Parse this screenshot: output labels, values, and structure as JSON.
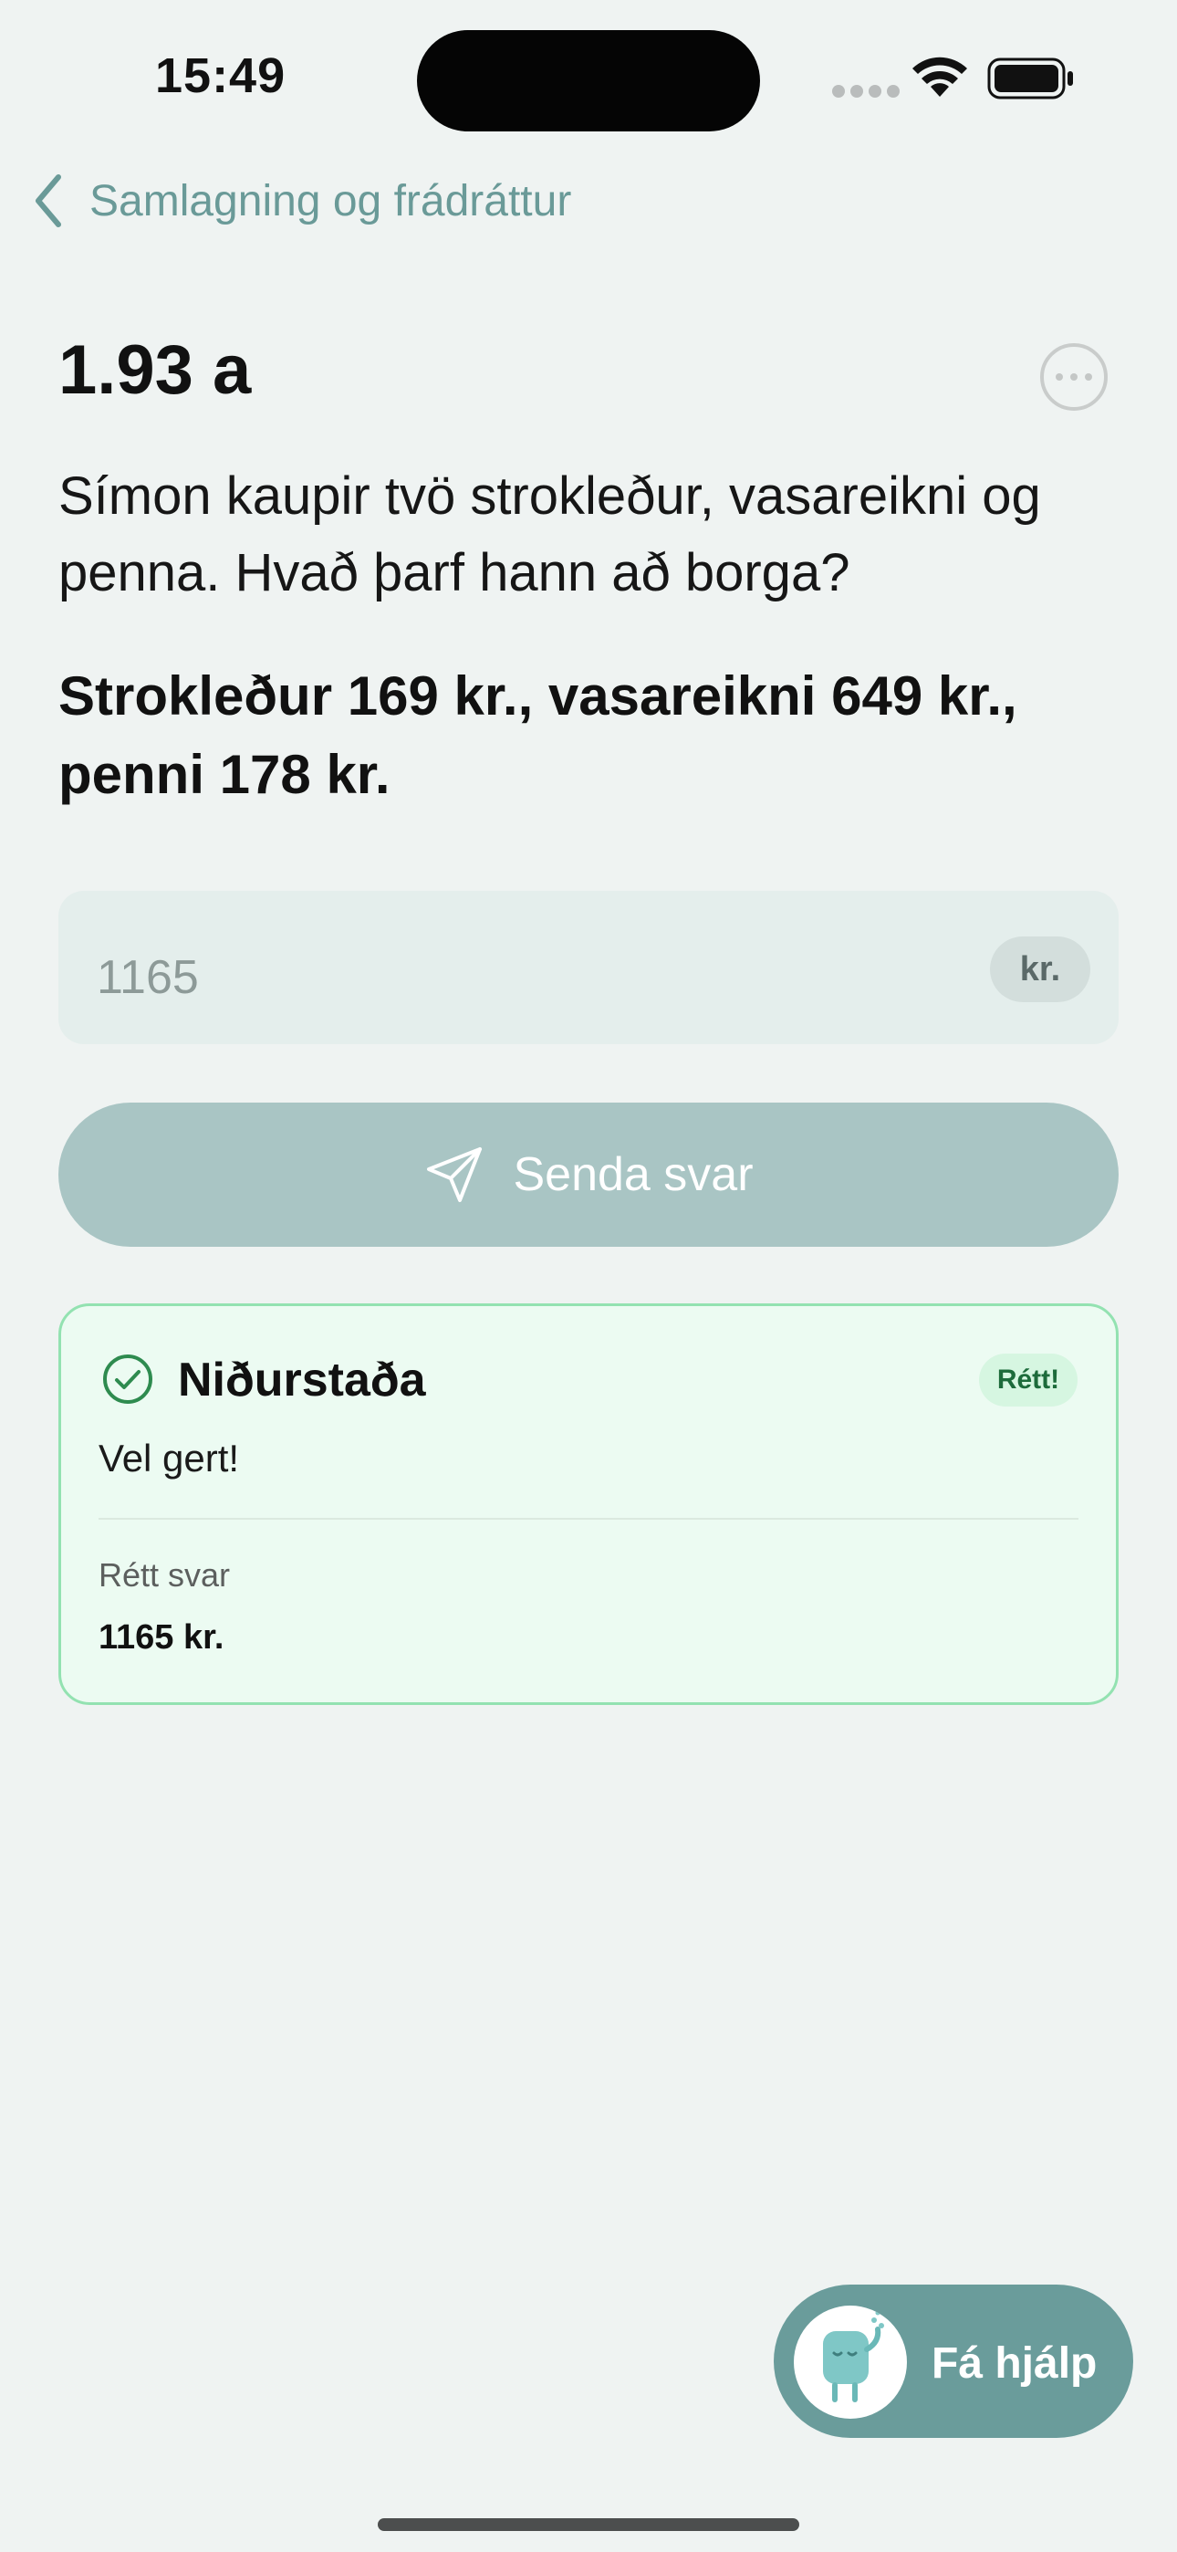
{
  "status_bar": {
    "time": "15:49"
  },
  "nav": {
    "back_label": "Samlagning og frádráttur"
  },
  "exercise": {
    "title": "1.93 a",
    "question": "Símon kaupir tvö strokleður, vasareikni og penna. Hvað þarf hann að borga?",
    "givens": "Strokleður 169 kr., vasareikni 649 kr., penni 178 kr."
  },
  "answer": {
    "value": "1165",
    "unit": "kr."
  },
  "submit": {
    "label": "Senda svar"
  },
  "result": {
    "title": "Niðurstaða",
    "badge": "Rétt!",
    "feedback": "Vel gert!",
    "correct_label": "Rétt svar",
    "correct_value": "1165 kr."
  },
  "help": {
    "label": "Fá hjálp"
  },
  "colors": {
    "background": "#eff3f2",
    "accent": "#6a9c9b",
    "success": "#2e8b4f"
  }
}
